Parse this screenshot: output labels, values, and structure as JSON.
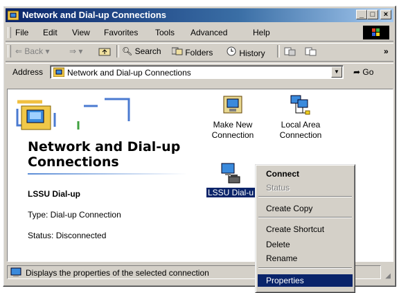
{
  "window": {
    "title": "Network and Dial-up Connections"
  },
  "menu": [
    "File",
    "Edit",
    "View",
    "Favorites",
    "Tools",
    "Advanced",
    "Help"
  ],
  "toolbar": {
    "back": "Back",
    "search": "Search",
    "folders": "Folders",
    "history": "History"
  },
  "address": {
    "label": "Address",
    "value": "Network and Dial-up Connections",
    "go": "Go"
  },
  "left_pane": {
    "title": "Network and Dial-up Connections",
    "selected_name": "LSSU Dial-up",
    "type": "Type: Dial-up Connection",
    "status": "Status: Disconnected"
  },
  "icons": [
    {
      "line1": "Make New",
      "line2": "Connection"
    },
    {
      "line1": "Local Area",
      "line2": "Connection"
    },
    {
      "label": "LSSU Dial-u"
    }
  ],
  "context_menu": [
    "Connect",
    "Status",
    "Create Copy",
    "Create Shortcut",
    "Delete",
    "Rename",
    "Properties"
  ],
  "statusbar": {
    "text": "Displays the properties of the selected connection"
  },
  "colors": {
    "titlebar": "#0a246a",
    "selection": "#0a246a",
    "face": "#d4d0c8"
  }
}
